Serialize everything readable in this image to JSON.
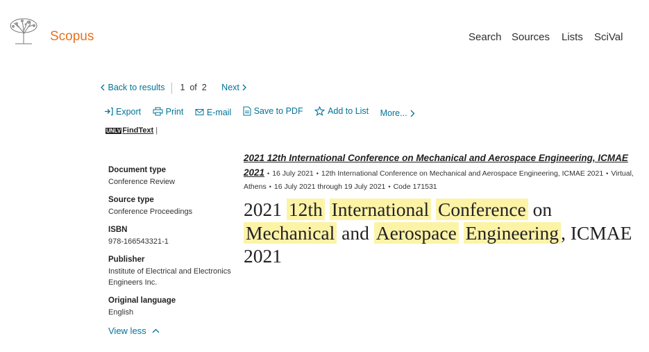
{
  "header": {
    "logo_text": "Scopus",
    "nav": [
      "Search",
      "Sources",
      "Lists",
      "SciVal"
    ]
  },
  "navigation": {
    "back_label": "Back to results",
    "position": "1",
    "of_word": "of",
    "total": "2",
    "next_label": "Next"
  },
  "actions": {
    "export": "Export",
    "print": "Print",
    "email": "E-mail",
    "save_pdf": "Save to PDF",
    "add_list": "Add to List",
    "more": "More..."
  },
  "findtext": {
    "badge": "UNLV",
    "label": "FindText"
  },
  "metadata": [
    {
      "label": "Document type",
      "value": "Conference Review"
    },
    {
      "label": "Source type",
      "value": "Conference Proceedings"
    },
    {
      "label": "ISBN",
      "value": "978-166543321-1"
    },
    {
      "label": "Publisher",
      "value": "Institute of Electrical and Electronics Engineers Inc."
    },
    {
      "label": "Original language",
      "value": "English"
    }
  ],
  "view_less": "View less",
  "source": {
    "title": "2021 12th International Conference on Mechanical and Aerospace Engineering, ICMAE 2021",
    "date": "16 July 2021",
    "conference_name": "12th International Conference on Mechanical and Aerospace Engineering, ICMAE 2021",
    "location": "Virtual, Athens",
    "dates": "16 July 2021 through 19 July 2021",
    "code": "Code 171531"
  },
  "document_title": {
    "p1": "2021",
    "w1": "12th",
    "w2": "International",
    "w3": "Conference",
    "p2": "on",
    "w4": "Mechanical",
    "p3": "and",
    "w5": "Aerospace",
    "w6": "Engineering",
    "p4": ", ICMAE 2021"
  },
  "colors": {
    "link": "#007398",
    "brand": "#e9711c",
    "highlight": "#fdf3a7"
  }
}
